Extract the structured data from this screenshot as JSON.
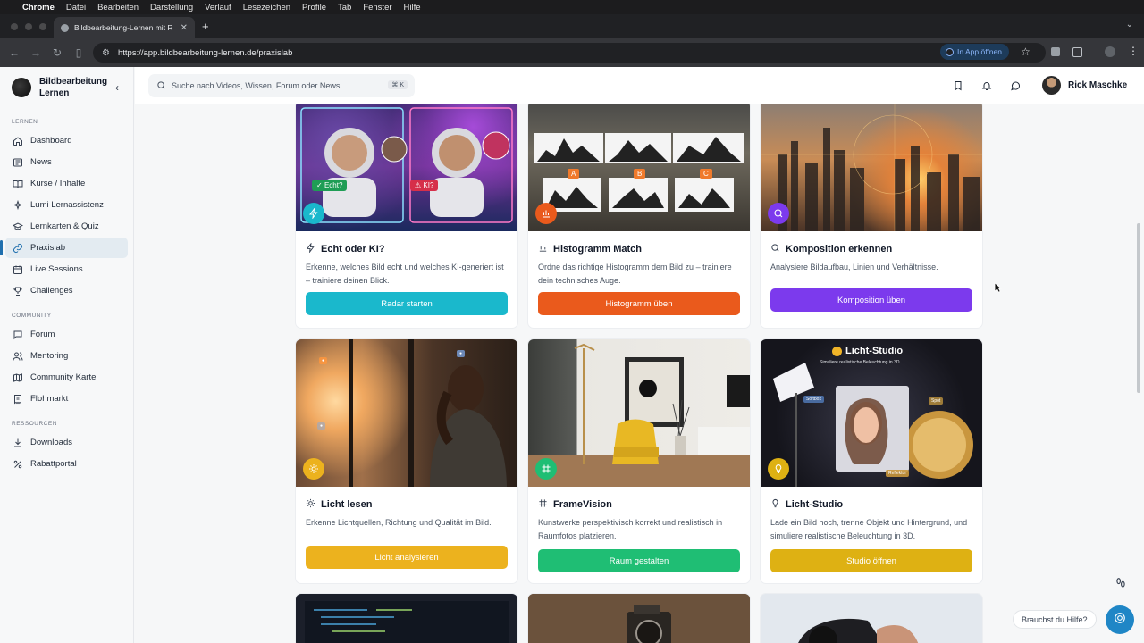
{
  "menubar": {
    "app": "Chrome",
    "items": [
      "Datei",
      "Bearbeiten",
      "Darstellung",
      "Verlauf",
      "Lesezeichen",
      "Profile",
      "Tab",
      "Fenster",
      "Hilfe"
    ]
  },
  "browser": {
    "tab_title": "Bildbearbeitung-Lernen mit R",
    "url": "https://app.bildbearbeitung-lernen.de/praxislab",
    "in_app_label": "In App öffnen"
  },
  "brand": {
    "name": "Bildbearbeitung Lernen"
  },
  "sidebar": {
    "sections": [
      {
        "label": "LERNEN",
        "items": [
          {
            "label": "Dashboard",
            "icon": "home-icon"
          },
          {
            "label": "News",
            "icon": "newspaper-icon"
          },
          {
            "label": "Kurse / Inhalte",
            "icon": "book-icon"
          },
          {
            "label": "Lumi Lernassistenz",
            "icon": "sparkle-icon"
          },
          {
            "label": "Lernkarten & Quiz",
            "icon": "graduation-icon"
          },
          {
            "label": "Praxislab",
            "icon": "link-icon",
            "active": true
          },
          {
            "label": "Live Sessions",
            "icon": "calendar-icon"
          },
          {
            "label": "Challenges",
            "icon": "trophy-icon"
          }
        ]
      },
      {
        "label": "COMMUNITY",
        "items": [
          {
            "label": "Forum",
            "icon": "chat-icon"
          },
          {
            "label": "Mentoring",
            "icon": "users-icon"
          },
          {
            "label": "Community Karte",
            "icon": "map-icon"
          },
          {
            "label": "Flohmarkt",
            "icon": "receipt-icon"
          }
        ]
      },
      {
        "label": "RESSOURCEN",
        "items": [
          {
            "label": "Downloads",
            "icon": "download-icon"
          },
          {
            "label": "Rabattportal",
            "icon": "percent-icon"
          }
        ]
      }
    ]
  },
  "header": {
    "search_placeholder": "Suche nach Videos, Wissen, Forum oder News...",
    "shortcut": "⌘ K",
    "user_name": "Rick Maschke"
  },
  "cards": [
    {
      "title": "Echt oder KI?",
      "desc": "Erkenne, welches Bild echt und welches KI-generiert ist – trainiere deinen Blick.",
      "cta": "Radar starten",
      "color": "#1ab8cc",
      "icon": "zap-icon",
      "img_labels": [
        "Echt?",
        "KI?"
      ]
    },
    {
      "title": "Histogramm Match",
      "desc": "Ordne das richtige Histogramm dem Bild zu – trainiere dein technisches Auge.",
      "cta": "Histogramm üben",
      "color": "#ea5a1c",
      "icon": "bar-chart-icon",
      "img_labels": [
        "A",
        "B",
        "C"
      ]
    },
    {
      "title": "Komposition erkennen",
      "desc": "Analysiere Bildaufbau, Linien und Verhältnisse.",
      "cta": "Komposition üben",
      "color": "#7c3aed",
      "icon": "search-icon"
    },
    {
      "title": "Licht lesen",
      "desc": "Erkenne Lichtquellen, Richtung und Qualität im Bild.",
      "cta": "Licht analysieren",
      "color": "#ecb21e",
      "icon": "sun-icon"
    },
    {
      "title": "FrameVision",
      "desc": "Kunstwerke perspektivisch korrekt und realistisch in Raumfotos platzieren.",
      "cta": "Raum gestalten",
      "color": "#1fbe74",
      "icon": "frame-icon"
    },
    {
      "title": "Licht-Studio",
      "desc": "Lade ein Bild hoch, trenne Objekt und Hintergrund, und simuliere realistische Beleuchtung in 3D.",
      "cta": "Studio öffnen",
      "color": "#deb113",
      "icon": "bulb-icon",
      "img_labels": [
        "Licht-Studio",
        "Simuliere realistische Beleuchtung in 3D",
        "Softbox",
        "Spot",
        "Reflektor"
      ]
    }
  ],
  "help": {
    "label": "Brauchst du Hilfe?"
  }
}
